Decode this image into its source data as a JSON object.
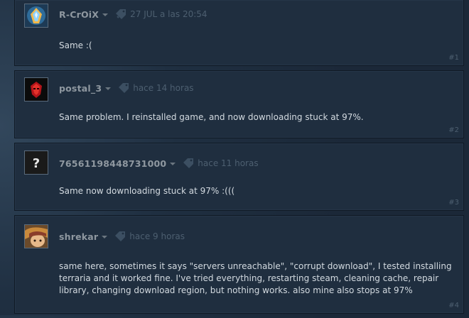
{
  "posts": [
    {
      "author": "R-CrOiX",
      "timestamp": "27 JUL a las 20:54",
      "text": "Same :(",
      "number": "#1",
      "avatar_icon": "crystal-avatar"
    },
    {
      "author": "postal_3",
      "timestamp": "hace 14 horas",
      "text": "Same problem. I reinstalled game, and now downloading stuck at 97%.",
      "number": "#2",
      "avatar_icon": "red-mask-avatar"
    },
    {
      "author": "76561198448731000",
      "timestamp": "hace 11 horas",
      "text": "Same now downloading stuck at 97% :(((",
      "number": "#3",
      "avatar_icon": "question-mark-avatar"
    },
    {
      "author": "shrekar",
      "timestamp": "hace 9 horas",
      "text": "same here, sometimes it says \"servers unreachable\", \"corrupt download\", I tested installing terraria and it worked fine. I've tried everything, restarting steam, cleaning cache, repair library, changing download region, but nothing works. also mine also stops at 97%",
      "number": "#4",
      "avatar_icon": "anime-character-avatar"
    }
  ],
  "colors": {
    "background": "#1b2838",
    "post_background": "#1f2e3f",
    "author": "#8f98a0",
    "text": "#d3dae0",
    "muted": "#4d5f70"
  }
}
